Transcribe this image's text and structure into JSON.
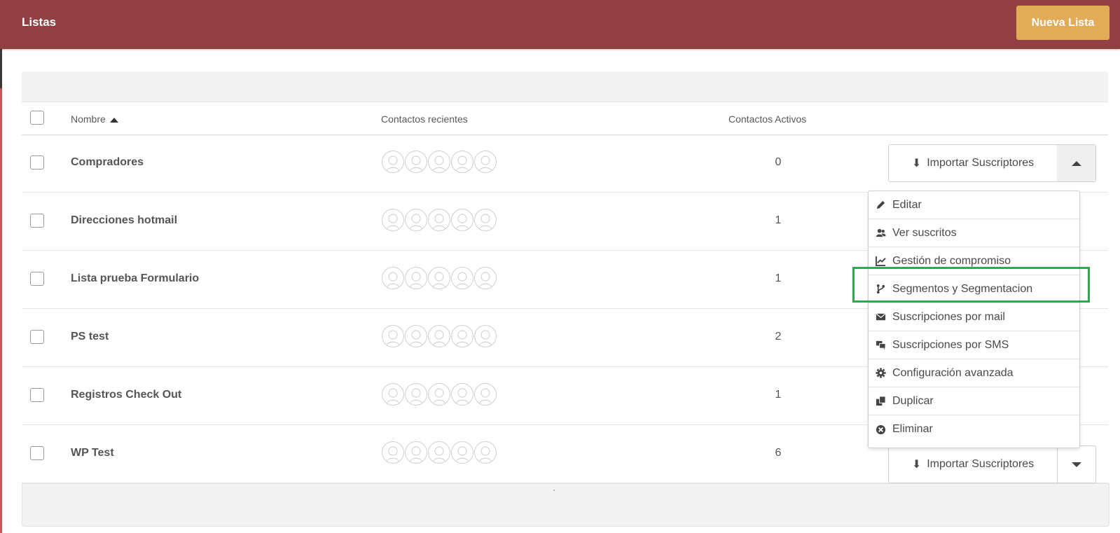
{
  "topbar": {
    "title": "Listas",
    "new_button": "Nueva Lista"
  },
  "table": {
    "headers": {
      "name": "Nombre",
      "recent": "Contactos recientes",
      "active": "Contactos Activos"
    },
    "rows": [
      {
        "name": "Compradores",
        "count": "0"
      },
      {
        "name": "Direcciones hotmail",
        "count": "1"
      },
      {
        "name": "Lista prueba Formulario",
        "count": "1"
      },
      {
        "name": "PS test",
        "count": "2"
      },
      {
        "name": "Registros Check Out",
        "count": "1"
      },
      {
        "name": "WP Test",
        "count": "6"
      }
    ],
    "import_label": "Importar Suscriptores"
  },
  "dropdown": {
    "items": [
      {
        "label": "Editar",
        "icon": "pencil-icon"
      },
      {
        "label": "Ver suscritos",
        "icon": "users-icon"
      },
      {
        "label": "Gestión de compromiso",
        "icon": "line-chart-icon"
      },
      {
        "label": "Segmentos y Segmentacion",
        "icon": "branch-icon"
      },
      {
        "label": "Suscripciones por mail",
        "icon": "envelope-icon"
      },
      {
        "label": "Suscripciones por SMS",
        "icon": "chat-icon"
      },
      {
        "label": "Configuración avanzada",
        "icon": "gear-icon"
      },
      {
        "label": "Duplicar",
        "icon": "copy-icon"
      },
      {
        "label": "Eliminar",
        "icon": "close-circle-icon"
      }
    ]
  },
  "colors": {
    "topbar": "#913f43",
    "accent": "#e2ab57",
    "highlight": "#2eaa4a"
  }
}
